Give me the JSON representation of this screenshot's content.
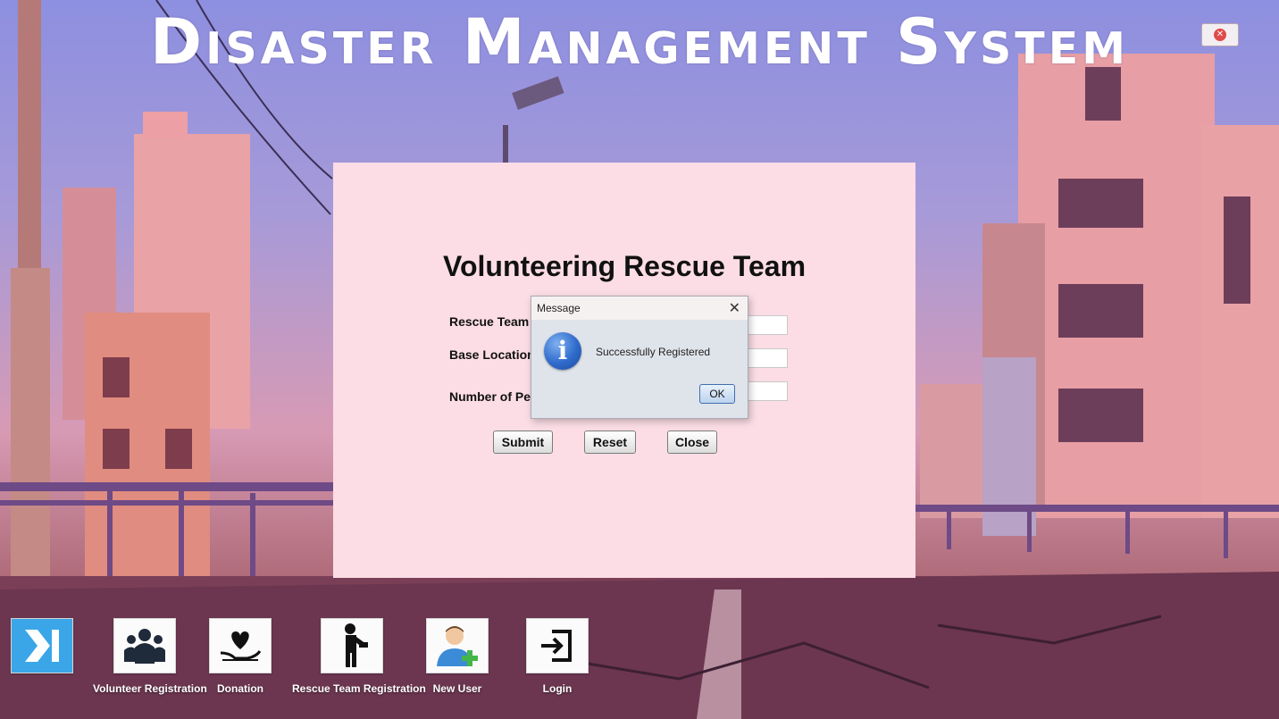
{
  "app": {
    "title": "Disaster Management System",
    "close_icon": "close-icon"
  },
  "form": {
    "title": "Volunteering Rescue Team",
    "fields": [
      {
        "label": "Rescue Team N",
        "value": ""
      },
      {
        "label": "Base Location",
        "value": ""
      },
      {
        "label": "Number of Pe",
        "value": ""
      }
    ],
    "buttons": {
      "submit": "Submit",
      "reset": "Reset",
      "close": "Close"
    }
  },
  "dialog": {
    "title": "Message",
    "message": "Successfully Registered",
    "ok_label": "OK",
    "icon": "info-icon"
  },
  "taskbar": {
    "items": [
      {
        "label": "",
        "icon": "next-arrow-icon"
      },
      {
        "label": "Volunteer Registration",
        "icon": "group-icon"
      },
      {
        "label": "Donation",
        "icon": "heart-hand-icon"
      },
      {
        "label": "Rescue Team Registration",
        "icon": "rescuer-icon"
      },
      {
        "label": "New User",
        "icon": "add-user-icon"
      },
      {
        "label": "Login",
        "icon": "login-icon"
      }
    ]
  },
  "colors": {
    "panel_bg": "#fcdde5",
    "accent_blue": "#2f6bcc",
    "title_text": "#ffffff"
  }
}
